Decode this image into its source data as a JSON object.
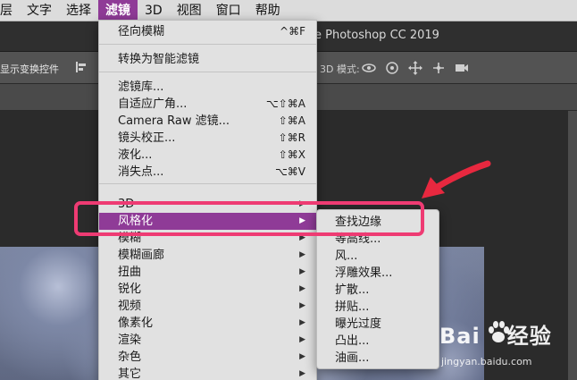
{
  "menubar": {
    "items": [
      {
        "label": "层",
        "active": false
      },
      {
        "label": "文字",
        "active": false
      },
      {
        "label": "选择",
        "active": false
      },
      {
        "label": "滤镜",
        "active": true
      },
      {
        "label": "3D",
        "active": false
      },
      {
        "label": "视图",
        "active": false
      },
      {
        "label": "窗口",
        "active": false
      },
      {
        "label": "帮助",
        "active": false
      }
    ]
  },
  "titlebar": {
    "title": "e Photoshop CC 2019"
  },
  "optionsbar": {
    "show_transform": "显示变换控件",
    "mode_3d": "3D 模式:"
  },
  "filter_menu": {
    "items": [
      {
        "label": "径向模糊",
        "shortcut": "^⌘F"
      },
      {
        "label": "转换为智能滤镜",
        "shortcut": ""
      },
      {
        "label": "滤镜库...",
        "shortcut": ""
      },
      {
        "label": "自适应广角...",
        "shortcut": "⌥⇧⌘A"
      },
      {
        "label": "Camera Raw 滤镜...",
        "shortcut": "⇧⌘A"
      },
      {
        "label": "镜头校正...",
        "shortcut": "⇧⌘R"
      },
      {
        "label": "液化...",
        "shortcut": "⇧⌘X"
      },
      {
        "label": "消失点...",
        "shortcut": "⌥⌘V"
      },
      {
        "label": "3D",
        "submenu": true
      },
      {
        "label": "风格化",
        "submenu": true,
        "selected": true
      },
      {
        "label": "模糊",
        "submenu": true
      },
      {
        "label": "模糊画廊",
        "submenu": true
      },
      {
        "label": "扭曲",
        "submenu": true
      },
      {
        "label": "锐化",
        "submenu": true
      },
      {
        "label": "视频",
        "submenu": true
      },
      {
        "label": "像素化",
        "submenu": true
      },
      {
        "label": "渲染",
        "submenu": true
      },
      {
        "label": "杂色",
        "submenu": true
      },
      {
        "label": "其它",
        "submenu": true
      }
    ],
    "arrow_glyph": "▶"
  },
  "stylize_submenu": {
    "items": [
      "查找边缘",
      "等高线...",
      "风...",
      "浮雕效果...",
      "扩散...",
      "拼贴...",
      "曝光过度",
      "凸出...",
      "油画..."
    ]
  },
  "watermark": {
    "brand": "Bai",
    "brand2": "经验",
    "url": "jingyan.baidu.com"
  },
  "colors": {
    "accent_purple": "#8f3b97",
    "highlight_pink": "#ee3b73",
    "arrow_red": "#e8283f",
    "menu_bg": "#e1e1e1"
  },
  "icons": [
    "align-icon",
    "orbit-3d-icon",
    "roll-3d-icon",
    "pan-3d-icon",
    "slide-3d-icon",
    "camera-3d-icon",
    "submenu-arrow-icon",
    "baidu-paw-icon"
  ]
}
